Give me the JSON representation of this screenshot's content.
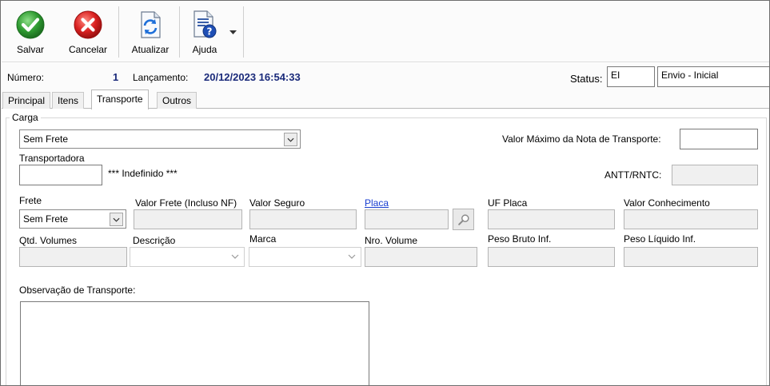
{
  "toolbar": {
    "save_label": "Salvar",
    "cancel_label": "Cancelar",
    "refresh_label": "Atualizar",
    "help_label": "Ajuda"
  },
  "header": {
    "numero_label": "Número:",
    "numero_value": "1",
    "lancamento_label": "Lançamento:",
    "lancamento_value": "20/12/2023 16:54:33",
    "status_label": "Status:",
    "status_code": "EI",
    "status_desc": "Envio - Inicial"
  },
  "tabs": [
    {
      "label": "Principal"
    },
    {
      "label": "Itens"
    },
    {
      "label": "Transporte"
    },
    {
      "label": "Outros"
    }
  ],
  "form": {
    "group_title": "Carga",
    "carga_select": "Sem Frete",
    "valor_maximo_label": "Valor Máximo da Nota de Transporte:",
    "valor_maximo_value": "",
    "transportadora_label": "Transportadora",
    "transportadora_value": "",
    "transportadora_name": "*** Indefinido ***",
    "antt_label": "ANTT/RNTC:",
    "antt_value": "",
    "frete_label": "Frete",
    "frete_value": "Sem Frete",
    "valor_frete_label": "Valor Frete (Incluso NF)",
    "valor_seguro_label": "Valor Seguro",
    "placa_label": "Placa",
    "uf_placa_label": "UF Placa",
    "valor_conhecimento_label": "Valor Conhecimento",
    "qtd_volumes_label": "Qtd. Volumes",
    "descricao_label": "Descrição",
    "marca_label": "Marca",
    "nro_volume_label": "Nro. Volume",
    "peso_bruto_label": "Peso Bruto Inf.",
    "peso_liquido_label": "Peso Líquido Inf.",
    "observacao_label": "Observação de Transporte:",
    "observacao_value": ""
  },
  "colors": {
    "header_value": "#1a2a7a",
    "link": "#1a3fd1",
    "disabled_bg": "#f0f0f0"
  },
  "icons": [
    "check-icon",
    "cancel-x-icon",
    "refresh-document-icon",
    "help-document-icon",
    "dropdown-arrow-icon",
    "magnifier-icon"
  ]
}
